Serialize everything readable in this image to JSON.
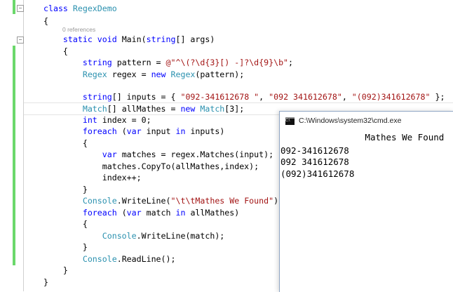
{
  "editor": {
    "codelens": [
      "0 references",
      "0 references"
    ],
    "lines": [
      [
        [
          "kw",
          "class "
        ],
        [
          "ty",
          "RegexDemo"
        ]
      ],
      [
        [
          "pl",
          "{"
        ]
      ],
      [
        [
          "pl",
          "    "
        ],
        [
          "kw",
          "static void "
        ],
        [
          "pl",
          "Main("
        ],
        [
          "kw",
          "string"
        ],
        [
          "pl",
          "[] args)"
        ]
      ],
      [
        [
          "pl",
          "    {"
        ]
      ],
      [
        [
          "pl",
          "        "
        ],
        [
          "kw",
          "string "
        ],
        [
          "pl",
          "pattern = "
        ],
        [
          "st",
          "@\"^\\(?\\d{3}[) -]?\\d{9}\\b\""
        ],
        [
          "pl",
          ";"
        ]
      ],
      [
        [
          "pl",
          "        "
        ],
        [
          "ty",
          "Regex "
        ],
        [
          "pl",
          "regex = "
        ],
        [
          "kw",
          "new "
        ],
        [
          "ty",
          "Regex"
        ],
        [
          "pl",
          "(pattern);"
        ]
      ],
      [
        [
          "pl",
          ""
        ]
      ],
      [
        [
          "pl",
          "        "
        ],
        [
          "kw",
          "string"
        ],
        [
          "pl",
          "[] inputs = { "
        ],
        [
          "st",
          "\"092-341612678 \""
        ],
        [
          "pl",
          ", "
        ],
        [
          "st",
          "\"092 341612678\""
        ],
        [
          "pl",
          ", "
        ],
        [
          "st",
          "\"(092)341612678\""
        ],
        [
          "pl",
          " };"
        ]
      ],
      [
        [
          "pl",
          "        "
        ],
        [
          "ty",
          "Match"
        ],
        [
          "pl",
          "[] allMathes = "
        ],
        [
          "kw",
          "new "
        ],
        [
          "ty",
          "Match"
        ],
        [
          "pl",
          "[3];"
        ]
      ],
      [
        [
          "pl",
          "        "
        ],
        [
          "kw",
          "int "
        ],
        [
          "pl",
          "index = 0;"
        ]
      ],
      [
        [
          "pl",
          "        "
        ],
        [
          "kw",
          "foreach "
        ],
        [
          "pl",
          "("
        ],
        [
          "kw",
          "var "
        ],
        [
          "pl",
          "input "
        ],
        [
          "kw",
          "in "
        ],
        [
          "pl",
          "inputs)"
        ]
      ],
      [
        [
          "pl",
          "        {"
        ]
      ],
      [
        [
          "pl",
          "            "
        ],
        [
          "kw",
          "var "
        ],
        [
          "pl",
          "matches = regex.Matches(input);"
        ]
      ],
      [
        [
          "pl",
          "            matches.CopyTo(allMathes,index);"
        ]
      ],
      [
        [
          "pl",
          "            index++;"
        ]
      ],
      [
        [
          "pl",
          "        }"
        ]
      ],
      [
        [
          "pl",
          "        "
        ],
        [
          "ty",
          "Console"
        ],
        [
          "pl",
          ".WriteLine("
        ],
        [
          "st",
          "\"\\t\\tMathes We Found\""
        ],
        [
          "pl",
          ");"
        ]
      ],
      [
        [
          "pl",
          "        "
        ],
        [
          "kw",
          "foreach "
        ],
        [
          "pl",
          "("
        ],
        [
          "kw",
          "var "
        ],
        [
          "pl",
          "match "
        ],
        [
          "kw",
          "in "
        ],
        [
          "pl",
          "allMathes)"
        ]
      ],
      [
        [
          "pl",
          "        {"
        ]
      ],
      [
        [
          "pl",
          "            "
        ],
        [
          "ty",
          "Console"
        ],
        [
          "pl",
          ".WriteLine(match);"
        ]
      ],
      [
        [
          "pl",
          "        }"
        ]
      ],
      [
        [
          "pl",
          "        "
        ],
        [
          "ty",
          "Console"
        ],
        [
          "pl",
          ".ReadLine();"
        ]
      ],
      [
        [
          "pl",
          "    }"
        ]
      ],
      [
        [
          "pl",
          "}"
        ]
      ]
    ]
  },
  "console": {
    "title": "C:\\Windows\\system32\\cmd.exe",
    "icon": "C:\\",
    "output": [
      "\t\tMathes We Found",
      "092-341612678",
      "092 341612678",
      "(092)341612678"
    ]
  },
  "colors": {
    "keyword": "#0000ff",
    "type": "#2b91af",
    "string": "#a31515",
    "change_bar": "#6bd86b"
  }
}
